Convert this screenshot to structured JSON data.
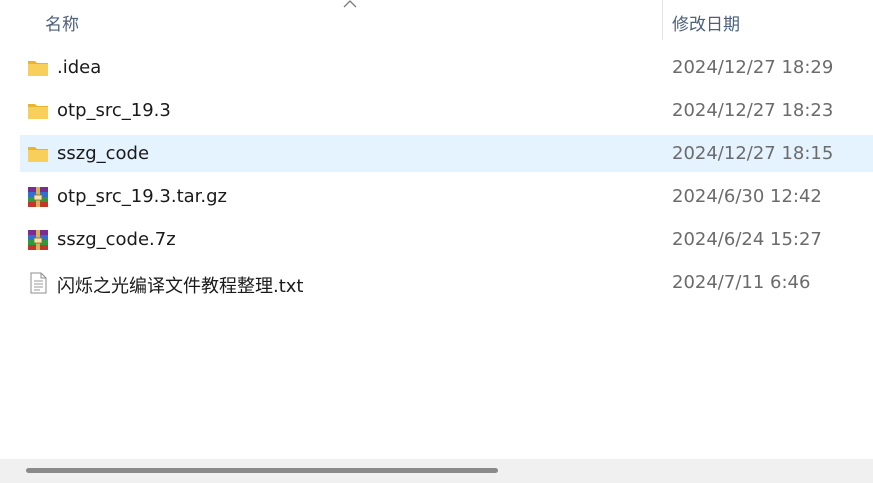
{
  "header": {
    "name_label": "名称",
    "date_label": "修改日期",
    "sort_direction": "ascending"
  },
  "files": [
    {
      "name": ".idea",
      "date": "2024/12/27 18:29",
      "icon": "folder-icon",
      "selected": false
    },
    {
      "name": "otp_src_19.3",
      "date": "2024/12/27 18:23",
      "icon": "folder-icon",
      "selected": false
    },
    {
      "name": "sszg_code",
      "date": "2024/12/27 18:15",
      "icon": "folder-icon",
      "selected": true
    },
    {
      "name": "otp_src_19.3.tar.gz",
      "date": "2024/6/30 12:42",
      "icon": "archive-icon",
      "selected": false
    },
    {
      "name": "sszg_code.7z",
      "date": "2024/6/24 15:27",
      "icon": "archive-icon",
      "selected": false
    },
    {
      "name": "闪烁之光编译文件教程整理.txt",
      "date": "2024/7/11 6:46",
      "icon": "text-file-icon",
      "selected": false
    }
  ],
  "colors": {
    "selection": "#e5f3ff",
    "folder": "#f6c84b",
    "header_text": "#4c607a"
  }
}
